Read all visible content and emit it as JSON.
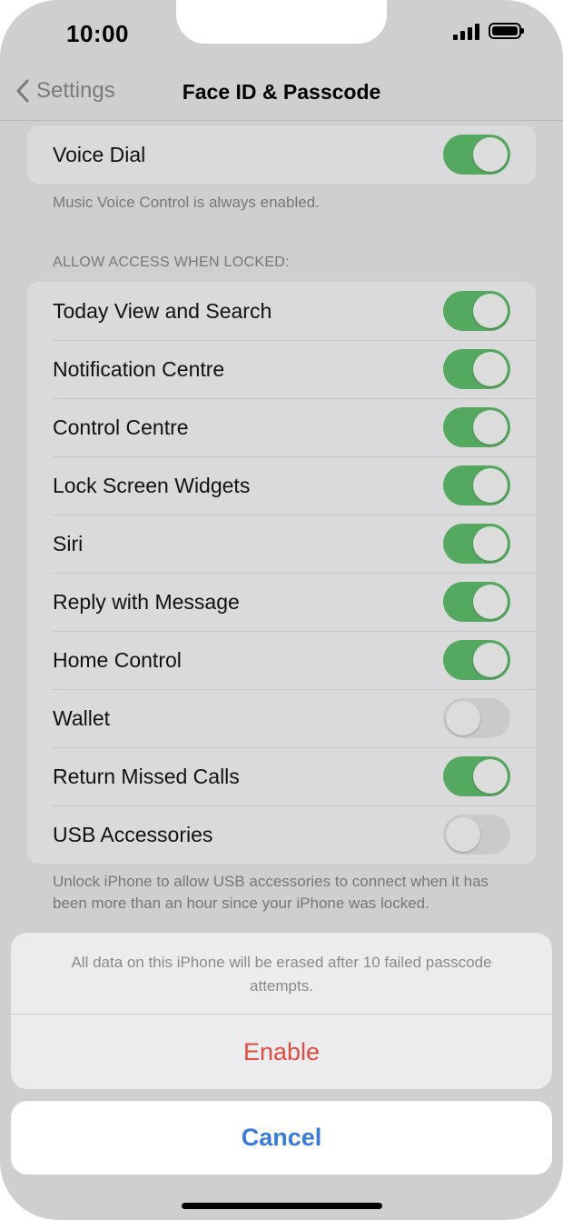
{
  "status_bar": {
    "time": "10:00"
  },
  "nav": {
    "back_label": "Settings",
    "title": "Face ID & Passcode"
  },
  "voice_dial": {
    "label": "Voice Dial",
    "on": true,
    "footnote": "Music Voice Control is always enabled."
  },
  "locked_access": {
    "header": "ALLOW ACCESS WHEN LOCKED:",
    "items": [
      {
        "label": "Today View and Search",
        "on": true
      },
      {
        "label": "Notification Centre",
        "on": true
      },
      {
        "label": "Control Centre",
        "on": true
      },
      {
        "label": "Lock Screen Widgets",
        "on": true
      },
      {
        "label": "Siri",
        "on": true
      },
      {
        "label": "Reply with Message",
        "on": true
      },
      {
        "label": "Home Control",
        "on": true
      },
      {
        "label": "Wallet",
        "on": false
      },
      {
        "label": "Return Missed Calls",
        "on": true
      },
      {
        "label": "USB Accessories",
        "on": false
      }
    ],
    "footnote": "Unlock iPhone to allow USB accessories to connect when it has been more than an hour since your iPhone was locked."
  },
  "action_sheet": {
    "message": "All data on this iPhone will be erased after 10 failed passcode attempts.",
    "enable_label": "Enable",
    "cancel_label": "Cancel"
  },
  "colors": {
    "toggle_on": "#55a85f",
    "toggle_off": "#cacacc",
    "destructive": "#de4d40",
    "accent": "#3a7bd8"
  }
}
